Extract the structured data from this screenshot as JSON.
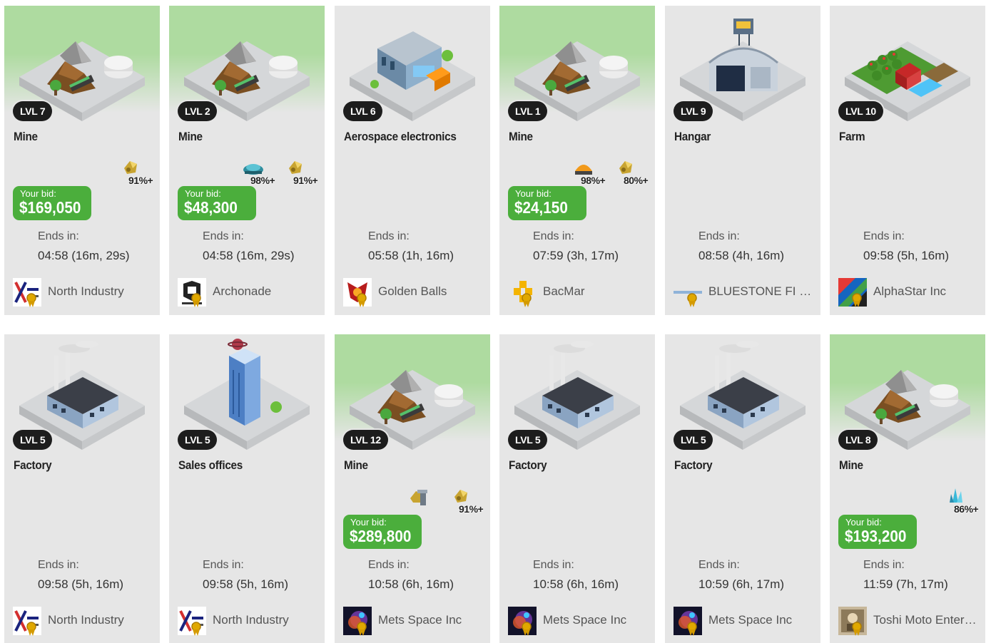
{
  "auctions": [
    {
      "level": "LVL 7",
      "title": "Mine",
      "art": "mine",
      "highlighted": true,
      "resources": [
        {
          "icon": "gold-ore-icon",
          "pct": "91%+"
        }
      ],
      "bid": {
        "label": "Your bid:",
        "value": "$169,050"
      },
      "ends_label": "Ends in:",
      "ends_value": "04:58 (16m, 29s)",
      "owner": {
        "name": "North Industry",
        "logo": "north-industry-logo"
      }
    },
    {
      "level": "LVL 2",
      "title": "Mine",
      "art": "mine",
      "highlighted": true,
      "resources": [
        {
          "icon": "blue-ore-icon",
          "pct": "98%+"
        },
        {
          "icon": "gold-ore-icon",
          "pct": "91%+"
        }
      ],
      "bid": {
        "label": "Your bid:",
        "value": "$48,300"
      },
      "ends_label": "Ends in:",
      "ends_value": "04:58 (16m, 29s)",
      "owner": {
        "name": "Archonade",
        "logo": "archonade-logo"
      }
    },
    {
      "level": "LVL 6",
      "title": "Aerospace electronics",
      "art": "aerospace",
      "highlighted": false,
      "resources": [],
      "bid": null,
      "ends_label": "Ends in:",
      "ends_value": "05:58 (1h, 16m)",
      "owner": {
        "name": "Golden Balls",
        "logo": "golden-balls-logo"
      }
    },
    {
      "level": "LVL 1",
      "title": "Mine",
      "art": "mine",
      "highlighted": true,
      "resources": [
        {
          "icon": "orange-ore-icon",
          "pct": "98%+"
        },
        {
          "icon": "gold-ore-icon",
          "pct": "80%+"
        }
      ],
      "bid": {
        "label": "Your bid:",
        "value": "$24,150"
      },
      "ends_label": "Ends in:",
      "ends_value": "07:59 (3h, 17m)",
      "owner": {
        "name": "BacMar",
        "logo": "bacmar-logo"
      }
    },
    {
      "level": "LVL 9",
      "title": "Hangar",
      "art": "hangar",
      "highlighted": false,
      "resources": [],
      "bid": null,
      "ends_label": "Ends in:",
      "ends_value": "08:58 (4h, 16m)",
      "owner": {
        "name": "BLUESTONE FI LLC",
        "logo": "bluestone-logo"
      }
    },
    {
      "level": "LVL 10",
      "title": "Farm",
      "art": "farm",
      "highlighted": false,
      "resources": [],
      "bid": null,
      "ends_label": "Ends in:",
      "ends_value": "09:58 (5h, 16m)",
      "owner": {
        "name": "AlphaStar Inc",
        "logo": "alphastar-logo"
      }
    },
    {
      "level": "LVL 5",
      "title": "Factory",
      "art": "factory",
      "highlighted": false,
      "resources": [],
      "bid": null,
      "ends_label": "Ends in:",
      "ends_value": "09:58 (5h, 16m)",
      "owner": {
        "name": "North Industry",
        "logo": "north-industry-logo"
      }
    },
    {
      "level": "LVL 5",
      "title": "Sales offices",
      "art": "offices",
      "highlighted": false,
      "resources": [],
      "bid": null,
      "ends_label": "Ends in:",
      "ends_value": "09:58 (5h, 16m)",
      "owner": {
        "name": "North Industry",
        "logo": "north-industry-logo"
      }
    },
    {
      "level": "LVL 12",
      "title": "Mine",
      "art": "mine",
      "highlighted": true,
      "resources": [
        {
          "icon": "machine-ore-icon",
          "pct": ""
        },
        {
          "icon": "gold-ore-icon",
          "pct": "91%+"
        }
      ],
      "bid": {
        "label": "Your bid:",
        "value": "$289,800"
      },
      "ends_label": "Ends in:",
      "ends_value": "10:58 (6h, 16m)",
      "owner": {
        "name": "Mets Space Inc",
        "logo": "mets-space-logo"
      }
    },
    {
      "level": "LVL 5",
      "title": "Factory",
      "art": "factory",
      "highlighted": false,
      "resources": [],
      "bid": null,
      "ends_label": "Ends in:",
      "ends_value": "10:58 (6h, 16m)",
      "owner": {
        "name": "Mets Space Inc",
        "logo": "mets-space-logo"
      }
    },
    {
      "level": "LVL 5",
      "title": "Factory",
      "art": "factory",
      "highlighted": false,
      "resources": [],
      "bid": null,
      "ends_label": "Ends in:",
      "ends_value": "10:59 (6h, 17m)",
      "owner": {
        "name": "Mets Space Inc",
        "logo": "mets-space-logo"
      }
    },
    {
      "level": "LVL 8",
      "title": "Mine",
      "art": "mine",
      "highlighted": true,
      "resources": [
        {
          "icon": "crystal-ore-icon",
          "pct": "86%+"
        }
      ],
      "bid": {
        "label": "Your bid:",
        "value": "$193,200"
      },
      "ends_label": "Ends in:",
      "ends_value": "11:59 (7h, 17m)",
      "owner": {
        "name": "Toshi Moto Enterp...",
        "logo": "toshi-moto-logo"
      }
    }
  ],
  "colors": {
    "card_bg": "#e6e6e6",
    "highlight": "#aedba0",
    "bid_green": "#4bae3c",
    "level_badge": "#1d1d1d"
  }
}
